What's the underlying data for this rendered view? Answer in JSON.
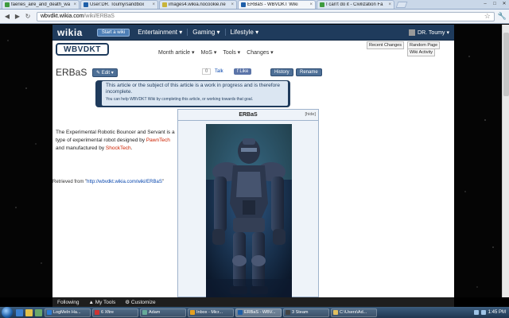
{
  "browser": {
    "tabs": [
      {
        "label": "faeries_aire_and_death_wa",
        "fav_color": "#3e9b3e",
        "active": false
      },
      {
        "label": "User:DR. Toumy/sandbox",
        "fav_color": "#1f5fa8",
        "active": false
      },
      {
        "label": "images4.wikia.nocookie.ne",
        "fav_color": "#c8b43a",
        "active": false
      },
      {
        "label": "ERBaS - WBVDKT Wiki",
        "fav_color": "#1f5fa8",
        "active": true
      },
      {
        "label": "I can't do it - Civilization Fa",
        "fav_color": "#3e9b3e",
        "active": false
      }
    ],
    "tab_close": "×",
    "url_host": "wbvdkt.wikia.com",
    "url_path": "/wiki/ERBaS",
    "back": "◀",
    "forward": "▶",
    "reload": "↻",
    "star": "☆",
    "wrench": "🔧",
    "min": "–",
    "max": "□",
    "close": "✕"
  },
  "wikia_bar": {
    "logo": "wikia",
    "start_wiki": "Start a wiki",
    "nav": [
      "Entertainment ▾",
      "Gaming ▾",
      "Lifestyle ▾"
    ],
    "user": "DR. Toumy ▾"
  },
  "wiki_header": {
    "wordmark": "WBVDKT",
    "local_nav": [
      "Month article ▾",
      "MoS ▾",
      "Tools ▾",
      "Changes ▾"
    ],
    "recent_changes": "Recent Changes",
    "random_page": "Random Page",
    "wiki_activity": "Wiki Activity"
  },
  "article": {
    "title": "ERBaS",
    "edit": "✎ Edit ▾",
    "comments": "0",
    "talk": "Talk",
    "like": "f Like",
    "history": "History",
    "rename": "Rename",
    "notice": "This article or the subject of this article is a work in progress and is therefore incomplete.",
    "notice_sub": "You can help WBVDKT Wiki by completing this article, or working towards that goal.",
    "body_a": "The Experimental Robotic Bouncer and Servant is a type of experimental robot designed by ",
    "body_link1": "PawnTech",
    "body_b": " and manufactured by ",
    "body_link2": "ShockTech",
    "body_c": ".",
    "retrieved_label": "Retrieved from \"",
    "retrieved_url": "http://wbvdkt.wikia.com/wiki/ERBaS",
    "retrieved_end": "\"",
    "infobox_title": "ERBaS",
    "infobox_hide": "[hide]"
  },
  "wikia_toolbar": {
    "items": [
      "Following",
      "▲ My Tools",
      "⚙ Customize"
    ]
  },
  "taskbar": {
    "items": [
      {
        "label": "LogMeIn Ha...",
        "color": "#2b7bd4"
      },
      {
        "label": "6 Xfire",
        "color": "#c33"
      },
      {
        "label": "Adam",
        "color": "#6a9"
      },
      {
        "label": "Inbox - Micr...",
        "color": "#e5a020"
      },
      {
        "label": "ERBaS - WBV...",
        "color": "#1f5fa8",
        "active": true
      },
      {
        "label": "3 Steam",
        "color": "#444"
      },
      {
        "label": "C:\\Users\\Ad...",
        "color": "#e0c060"
      }
    ],
    "time": "1:45 PM"
  }
}
